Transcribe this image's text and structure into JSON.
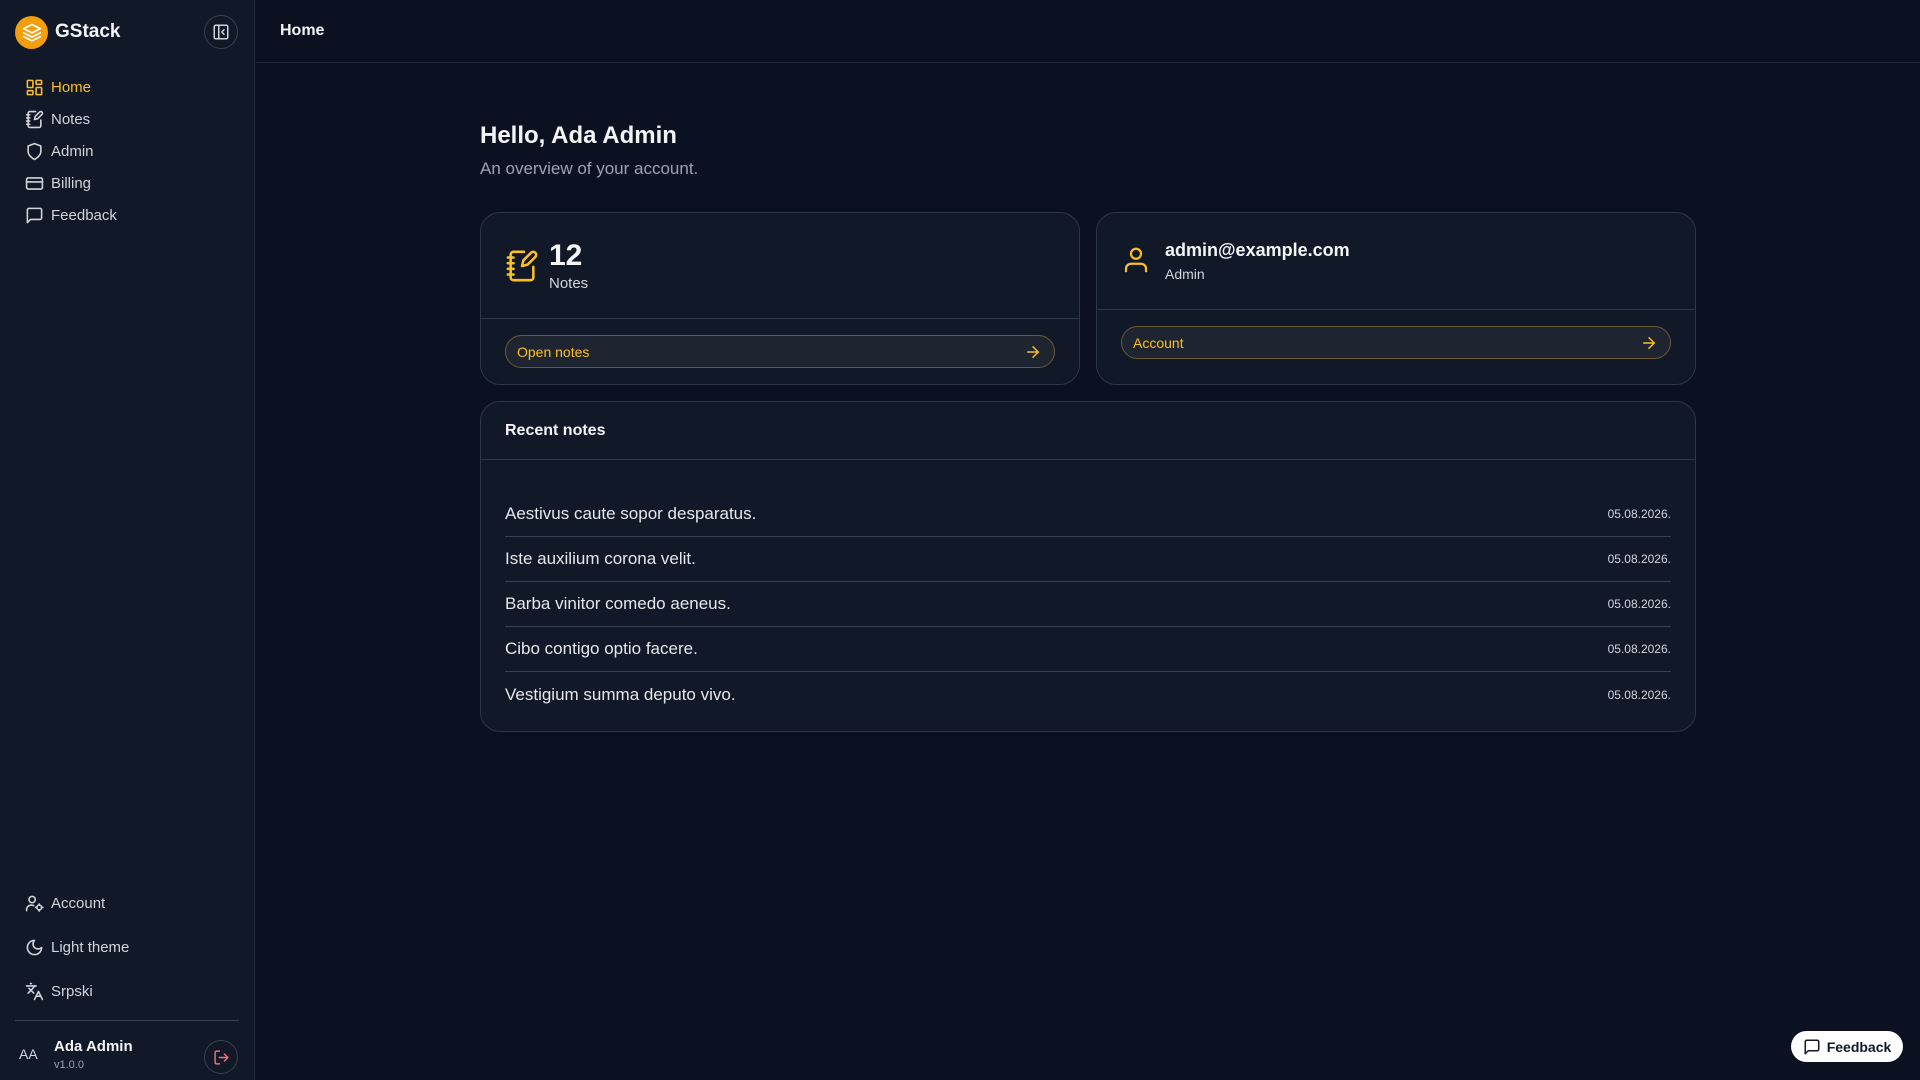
{
  "brand": {
    "name": "GStack"
  },
  "colors": {
    "accent": "#fbbf24",
    "background": "#0b1120",
    "sidebar": "#111827",
    "danger": "#f87171"
  },
  "sidebar": {
    "nav": [
      {
        "label": "Home",
        "icon": "layout-grid-icon",
        "active": true
      },
      {
        "label": "Notes",
        "icon": "notebook-pen-icon",
        "active": false
      },
      {
        "label": "Admin",
        "icon": "shield-icon",
        "active": false
      },
      {
        "label": "Billing",
        "icon": "credit-card-icon",
        "active": false
      },
      {
        "label": "Feedback",
        "icon": "message-square-icon",
        "active": false
      }
    ],
    "bottom": [
      {
        "label": "Account",
        "icon": "user-cog-icon"
      },
      {
        "label": "Light theme",
        "icon": "moon-icon"
      },
      {
        "label": "Srpski",
        "icon": "languages-icon"
      }
    ],
    "user": {
      "initials": "AA",
      "name": "Ada Admin",
      "version": "v1.0.0"
    }
  },
  "header": {
    "breadcrumb": "Home"
  },
  "main": {
    "greeting": "Hello, Ada Admin",
    "subtitle": "An overview of your account.",
    "notes_card": {
      "count": "12",
      "label": "Notes",
      "button": "Open notes",
      "icon": "notebook-pen-icon"
    },
    "account_card": {
      "email": "admin@example.com",
      "role": "Admin",
      "button": "Account",
      "icon": "user-icon"
    },
    "recent": {
      "title": "Recent notes",
      "items": [
        {
          "title": "Aestivus caute sopor desparatus.",
          "date": "05.08.2026."
        },
        {
          "title": "Iste auxilium corona velit.",
          "date": "05.08.2026."
        },
        {
          "title": "Barba vinitor comedo aeneus.",
          "date": "05.08.2026."
        },
        {
          "title": "Cibo contigo optio facere.",
          "date": "05.08.2026."
        },
        {
          "title": "Vestigium summa deputo vivo.",
          "date": "05.08.2026."
        }
      ]
    }
  },
  "fab": {
    "label": "Feedback",
    "icon": "message-square-icon"
  }
}
